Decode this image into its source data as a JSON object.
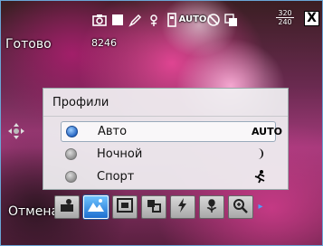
{
  "status": {
    "mode_text": "Готово",
    "shots_remaining": "8246",
    "icon_text_auto": "AUTO",
    "resolution_top": "320",
    "resolution_bottom": "240",
    "close_label": "X"
  },
  "dialog": {
    "title": "Профили",
    "options": [
      {
        "label": "Авто",
        "icon": "auto-mode-icon",
        "icon_text": "AUTO",
        "selected": true
      },
      {
        "label": "Ночной",
        "icon": "night-moon-icon",
        "selected": false
      },
      {
        "label": "Спорт",
        "icon": "sport-runner-icon",
        "selected": false
      }
    ]
  },
  "softkeys": {
    "left": "Отмена"
  },
  "toolbar": {
    "items": [
      "portrait-profile-icon",
      "landscape-icon",
      "frame-icon",
      "cross-process-icon",
      "flash-icon",
      "macro-flower-icon",
      "zoom-icon"
    ],
    "active_index": 1,
    "more_arrow": "▸"
  },
  "colors": {
    "accent_blue": "#1e6fd0",
    "frame_border": "#6aa6d6"
  }
}
